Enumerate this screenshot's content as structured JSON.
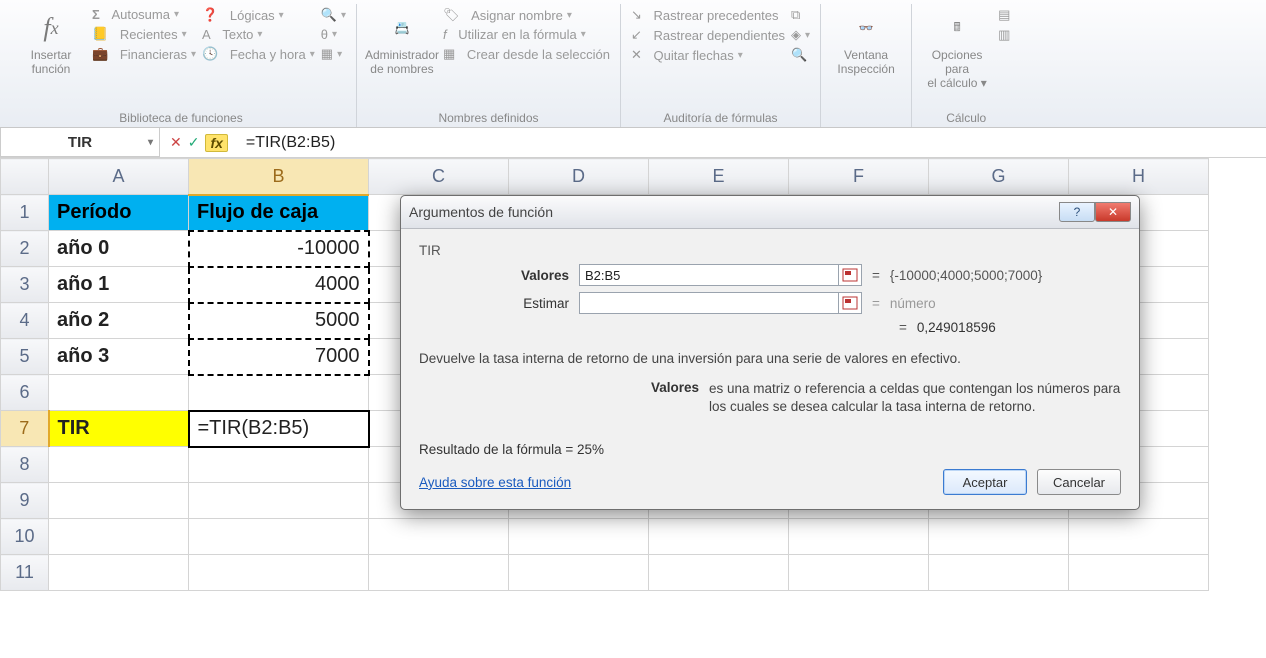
{
  "ribbon": {
    "insert_function": "Insertar función",
    "fx": "fx",
    "lib": {
      "autosuma": "Autosuma",
      "recientes": "Recientes",
      "financieras": "Financieras",
      "logicas": "Lógicas",
      "texto": "Texto",
      "fechahora": "Fecha y hora",
      "title": "Biblioteca de funciones"
    },
    "names": {
      "admin1": "Administrador",
      "admin2": "de nombres",
      "asignar": "Asignar nombre",
      "utilizar": "Utilizar en la fórmula",
      "crear": "Crear desde la selección",
      "title": "Nombres definidos"
    },
    "audit": {
      "prec": "Rastrear precedentes",
      "dep": "Rastrear dependientes",
      "quitar": "Quitar flechas",
      "title": "Auditoría de fórmulas"
    },
    "ventana1": "Ventana",
    "ventana2": "Inspección",
    "calc": {
      "opt1": "Opciones para",
      "opt2": "el cálculo",
      "title": "Cálculo"
    }
  },
  "formula_bar": {
    "name_box": "TIR",
    "formula": "=TIR(B2:B5)"
  },
  "columns": [
    "A",
    "B",
    "C",
    "D",
    "E",
    "F",
    "G",
    "H"
  ],
  "rows": [
    "1",
    "2",
    "3",
    "4",
    "5",
    "6",
    "7",
    "8",
    "9",
    "10",
    "11"
  ],
  "cells": {
    "A1": "Período",
    "B1": "Flujo de caja",
    "A2": "año 0",
    "B2": "-10000",
    "A3": "año 1",
    "B3": "4000",
    "A4": "año 2",
    "B4": "5000",
    "A5": "año 3",
    "B5": "7000",
    "A7": "TIR",
    "B7": "=TIR(B2:B5)"
  },
  "dialog": {
    "title": "Argumentos de función",
    "fn": "TIR",
    "args": {
      "valores_label": "Valores",
      "valores_value": "B2:B5",
      "valores_result": "{-10000;4000;5000;7000}",
      "estimar_label": "Estimar",
      "estimar_value": "",
      "estimar_result": "número"
    },
    "intermediate": "0,249018596",
    "description": "Devuelve la tasa interna de retorno de una inversión para una serie de valores en efectivo.",
    "arg_help_label": "Valores",
    "arg_help_text": "es una matriz o referencia a celdas que contengan los números para los cuales se desea calcular la tasa interna de retorno.",
    "result_label": "Resultado de la fórmula = ",
    "result_value": "25%",
    "help_link": "Ayuda sobre esta función",
    "ok": "Aceptar",
    "cancel": "Cancelar"
  }
}
